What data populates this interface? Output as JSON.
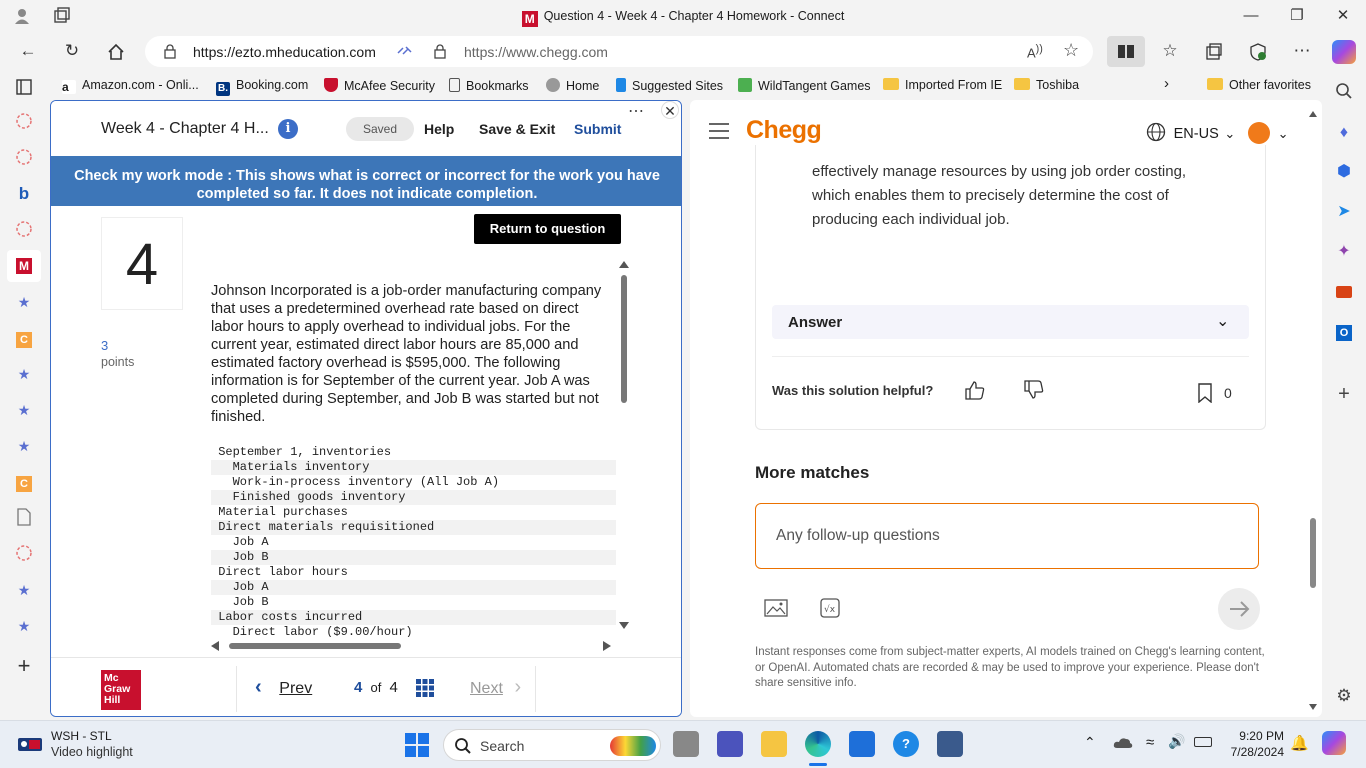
{
  "window": {
    "title": "Question 4 - Week 4 - Chapter 4 Homework - Connect",
    "minimize": "—",
    "restore": "❐",
    "close": "✕"
  },
  "address": {
    "url_left": "https://ezto.mheducation.com",
    "url_right": "https://www.chegg.com"
  },
  "favorites": [
    {
      "label": "Amazon.com - Onli...",
      "color": "#222222"
    },
    {
      "label": "Booking.com",
      "color": "#003580"
    },
    {
      "label": "McAfee Security",
      "color": "#c8102e"
    },
    {
      "label": "Bookmarks",
      "color": "#ffffff"
    },
    {
      "label": "Home",
      "color": "#888888"
    },
    {
      "label": "Suggested Sites",
      "color": "#1e88e5"
    },
    {
      "label": "WildTangent Games",
      "color": "#4caf50"
    },
    {
      "label": "Imported From IE",
      "color": "folder"
    },
    {
      "label": "Toshiba",
      "color": "folder"
    }
  ],
  "favorites_more": "Other favorites",
  "connect": {
    "title": "Week 4 - Chapter 4 H...",
    "info": "i",
    "saved": "Saved",
    "help": "Help",
    "save_exit": "Save & Exit",
    "submit": "Submit",
    "banner": "Check my work mode : This shows what is correct or incorrect for the work you have completed so far. It does not indicate completion.",
    "question_number": "4",
    "points_value": "3",
    "points_label": "points",
    "return_button": "Return to question",
    "question_text": "Johnson Incorporated is a job-order manufacturing company that uses a predetermined overhead rate based on direct labor hours to apply overhead to individual jobs. For the current year, estimated direct labor hours are 85,000 and estimated factory overhead is $595,000. The following information is for September of the current year. Job A was completed during September, and Job B was started but not finished.",
    "table_rows": [
      " September 1, inventories",
      "   Materials inventory                                    $",
      "   Work-in-process inventory (All Job A)",
      "   Finished goods inventory",
      " Material purchases",
      " Direct materials requisitioned",
      "   Job A",
      "   Job B",
      " Direct labor hours",
      "   Job A",
      "   Job B",
      " Labor costs incurred",
      "   Direct labor ($9.00/hour)"
    ],
    "prev": "Prev",
    "page_current": "4",
    "page_of": "of",
    "page_total": "4",
    "next": "Next",
    "logo": [
      "Mc",
      "Graw",
      "Hill"
    ]
  },
  "chegg": {
    "logo": "Chegg",
    "language": "EN-US",
    "explanation": "effectively manage resources by using job order costing, which enables them to precisely determine the cost of producing each individual job.",
    "answer_label": "Answer",
    "helpful_question": "Was this solution helpful?",
    "bookmark_count": "0",
    "more_matches": "More matches",
    "followup_placeholder": "Any follow-up questions",
    "disclaimer": "Instant responses come from subject-matter experts, AI models trained on Chegg's learning content, or OpenAI. Automated chats are recorded & may be used to improve your experience. Please don't share sensitive info."
  },
  "taskbar": {
    "news_title": "WSH - STL",
    "news_sub": "Video highlight",
    "search": "Search",
    "time": "9:20 PM",
    "date": "7/28/2024"
  }
}
